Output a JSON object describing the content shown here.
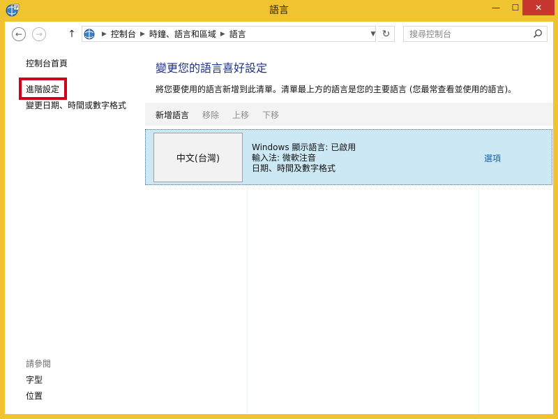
{
  "window": {
    "title": "語言",
    "minimize_glyph": "—",
    "maximize_glyph": "☐",
    "close_glyph": "✕"
  },
  "address": {
    "breadcrumbs": [
      "控制台",
      "時鐘、語言和區域",
      "語言"
    ],
    "search_placeholder": "搜尋控制台"
  },
  "sidebar": {
    "home": "控制台首頁",
    "advanced": "進階設定",
    "date_format": "變更日期、時間或數字格式",
    "see_also_header": "請參閱",
    "see_also_fonts": "字型",
    "see_also_location": "位置"
  },
  "main": {
    "title": "變更您的語言喜好設定",
    "description": "將您要使用的語言新增到此清單。清單最上方的語言是您的主要語言 (您最常查看並使用的語言)。",
    "toolbar": {
      "add": "新增語言",
      "remove": "移除",
      "move_up": "上移",
      "move_down": "下移"
    },
    "languages": [
      {
        "name": "中文(台灣)",
        "line1": "Windows 顯示語言: 已啟用",
        "line2": "輸入法: 微軟注音",
        "line3": "日期、時間及數字格式",
        "options": "選項"
      }
    ]
  },
  "colors": {
    "accent_frame": "#f0c431",
    "title_link": "#1e3287",
    "selected_row": "#cce8f4",
    "highlight_box": "#d0021b",
    "close_button": "#c7372f"
  }
}
